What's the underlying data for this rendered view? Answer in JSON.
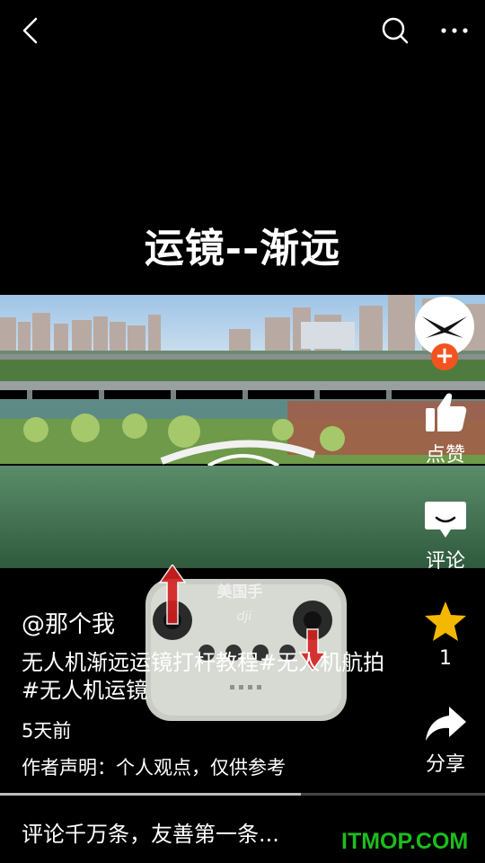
{
  "overlay_title": "运镜--渐远",
  "controller_caption": "美国手",
  "controller_brand": "dji",
  "author": {
    "name": "@那个我"
  },
  "description": "无人机渐远运镜打杆教程#无人机航拍#无人机运镜",
  "time": "5天前",
  "declaration": "作者声明：个人观点，仅供参考",
  "actions": {
    "like_label": "点赞",
    "comment_label": "评论",
    "favorite_count": "1",
    "share_label": "分享"
  },
  "progress": 0.62,
  "comment_input": {
    "placeholder": "评论千万条，友善第一条..."
  },
  "watermark": "ITMOP.COM",
  "colors": {
    "follow_badge": "#f4531f",
    "star": "#f5b800",
    "watermark": "#1dbd1d"
  }
}
